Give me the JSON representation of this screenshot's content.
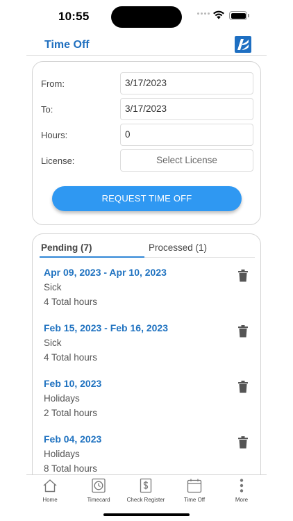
{
  "status_bar": {
    "time": "10:55"
  },
  "header": {
    "title": "Time Off",
    "logo_icon": "company-logo-icon"
  },
  "form": {
    "from_label": "From:",
    "from_value": "3/17/2023",
    "to_label": "To:",
    "to_value": "3/17/2023",
    "hours_label": "Hours:",
    "hours_value": "0",
    "license_label": "License:",
    "license_value": "Select License",
    "submit_label": "REQUEST TIME OFF"
  },
  "tabs": [
    {
      "label": "Pending (7)",
      "active": true
    },
    {
      "label": "Processed (1)",
      "active": false
    }
  ],
  "requests": [
    {
      "date": "Apr 09, 2023 - Apr 10, 2023",
      "type": "Sick",
      "hours": "4 Total hours"
    },
    {
      "date": "Feb 15, 2023 - Feb 16, 2023",
      "type": "Sick",
      "hours": "4 Total hours"
    },
    {
      "date": "Feb 10, 2023",
      "type": "Holidays",
      "hours": "2 Total hours"
    },
    {
      "date": "Feb 04, 2023",
      "type": "Holidays",
      "hours": "8 Total hours"
    }
  ],
  "nav": [
    {
      "label": "Home",
      "icon": "home-icon"
    },
    {
      "label": "Timecard",
      "icon": "clock-icon"
    },
    {
      "label": "Check Register",
      "icon": "dollar-document-icon"
    },
    {
      "label": "Time Off",
      "icon": "calendar-icon"
    },
    {
      "label": "More",
      "icon": "more-vertical-icon"
    }
  ],
  "colors": {
    "accent": "#2f98f2",
    "title_blue": "#1f6fbf",
    "link_blue": "#1f72c0"
  }
}
